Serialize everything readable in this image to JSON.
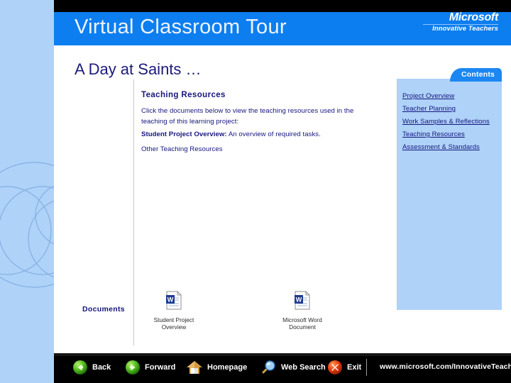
{
  "header": {
    "title": "Virtual Classroom Tour",
    "brand_name": "Microsoft",
    "brand_tagline": "Innovative Teachers"
  },
  "slide": {
    "title": "A Day at Saints …",
    "contents_tab_label": "Contents",
    "documents_label": "Documents"
  },
  "content": {
    "heading": "Teaching Resources",
    "paragraph": "Click the documents below to view the teaching resources used in the teaching of this learning project:",
    "items": [
      {
        "bold": "Student Project Overview:",
        "rest": " An overview of required tasks."
      },
      {
        "bold": "",
        "rest": "Other Teaching Resources"
      }
    ]
  },
  "nav_panel": {
    "links": [
      {
        "label": "Project Overview"
      },
      {
        "label": "Teacher Planning"
      },
      {
        "label": "Work Samples & Reflections"
      },
      {
        "label": "Teaching Resources"
      },
      {
        "label": "Assessment & Standards"
      }
    ]
  },
  "documents": [
    {
      "icon": "word-document-icon",
      "line1": "Student Project",
      "line2": "Overview"
    },
    {
      "icon": "word-document-icon",
      "line1": "Microsoft Word",
      "line2": "Document"
    }
  ],
  "bottom_bar": {
    "buttons": [
      {
        "icon": "back-arrow-icon",
        "label": "Back"
      },
      {
        "icon": "forward-arrow-icon",
        "label": "Forward"
      },
      {
        "icon": "house-icon",
        "label": "Homepage"
      },
      {
        "icon": "magnifier-icon",
        "label": "Web Search"
      },
      {
        "icon": "exit-x-icon",
        "label": "Exit"
      }
    ],
    "url": "www.microsoft.com/InnovativeTeachers"
  },
  "colors": {
    "header_blue": "#0d7ef0",
    "rail_blue": "#aed2f8",
    "navy_text": "#16167e",
    "bar_black": "#000000"
  }
}
